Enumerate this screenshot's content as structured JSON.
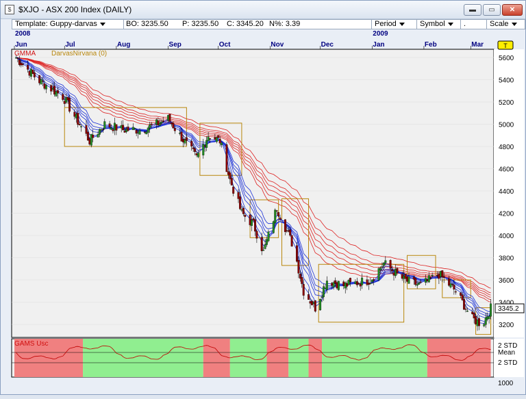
{
  "window": {
    "title": "$XJO - ASX 200 Index (DAILY)",
    "buttons": {
      "minimize": "▬",
      "maximize": "▭",
      "close": "✕"
    }
  },
  "toolbar": {
    "template_label": "Template: Guppy-darvas",
    "bo": "BO: 3235.50",
    "p": "P: 3235.50",
    "c": "C: 3345.20",
    "n": "N%: 3.39",
    "period_label": "Period",
    "symbol_label": "Symbol",
    "dot_label": ".",
    "scale_label": "Scale"
  },
  "chart": {
    "year_labels": [
      {
        "text": "2008",
        "date": "2008-06"
      },
      {
        "text": "2009",
        "date": "2009-01"
      }
    ],
    "month_labels": [
      "Jun",
      "Jul",
      "Aug",
      "Sep",
      "Oct",
      "Nov",
      "Dec",
      "Jan",
      "Feb",
      "Mar"
    ],
    "t_marker": "T",
    "indicator_gmma": "GMMA",
    "indicator_darvas": "DarvasNirvana (0)",
    "price_ticks": [
      "5600",
      "5400",
      "5200",
      "5000",
      "4800",
      "4600",
      "4400",
      "4200",
      "4000",
      "3800",
      "3600",
      "3400",
      "3200"
    ],
    "last_price_label": "3345.2",
    "osc_title": "GAMS Usc",
    "osc_labels": [
      "2 STD",
      "Mean",
      "2 STD"
    ],
    "osc_bottom_label": "1000",
    "colors": {
      "background": "#f0f0f0",
      "axis_text": "#000080",
      "long_mas": "#dd2222",
      "short_mas": "#1a2fd6",
      "darvas_box": "#b8860b",
      "osc_red": "#f08080",
      "osc_green": "#90ee90",
      "osc_line": "#c00000",
      "up_candle": "#228b22",
      "down_candle": "#8b0000"
    }
  },
  "chart_data": {
    "type": "candlestick-with-indicators",
    "symbol": "$XJO",
    "range": [
      "2008-06",
      "2009-03"
    ],
    "ylim": [
      3100,
      5650
    ],
    "y_ticks": [
      3200,
      3400,
      3600,
      3800,
      4000,
      4200,
      4400,
      4600,
      4800,
      5000,
      5200,
      5400,
      5600
    ],
    "last_close": 3345.2,
    "path": [
      [
        "2008-06-02",
        5600
      ],
      [
        "2008-06-15",
        5400
      ],
      [
        "2008-06-30",
        5250
      ],
      [
        "2008-07-10",
        5000
      ],
      [
        "2008-07-16",
        4850
      ],
      [
        "2008-07-25",
        5000
      ],
      [
        "2008-08-05",
        4950
      ],
      [
        "2008-08-15",
        4950
      ],
      [
        "2008-08-25",
        5000
      ],
      [
        "2008-09-01",
        5050
      ],
      [
        "2008-09-08",
        4900
      ],
      [
        "2008-09-18",
        4700
      ],
      [
        "2008-09-25",
        4900
      ],
      [
        "2008-10-02",
        4850
      ],
      [
        "2008-10-08",
        4500
      ],
      [
        "2008-10-15",
        4200
      ],
      [
        "2008-10-22",
        4100
      ],
      [
        "2008-10-28",
        3850
      ],
      [
        "2008-11-05",
        4250
      ],
      [
        "2008-11-15",
        3900
      ],
      [
        "2008-11-21",
        3500
      ],
      [
        "2008-11-28",
        3350
      ],
      [
        "2008-12-05",
        3600
      ],
      [
        "2008-12-15",
        3550
      ],
      [
        "2008-12-31",
        3600
      ],
      [
        "2009-01-08",
        3750
      ],
      [
        "2009-01-20",
        3600
      ],
      [
        "2009-01-30",
        3550
      ],
      [
        "2009-02-10",
        3650
      ],
      [
        "2009-02-20",
        3500
      ],
      [
        "2009-03-02",
        3250
      ],
      [
        "2009-03-08",
        3200
      ],
      [
        "2009-03-13",
        3345
      ]
    ],
    "darvas_boxes": [
      {
        "start": "2008-07-01",
        "end": "2008-09-12",
        "high": 5150,
        "low": 4800
      },
      {
        "start": "2008-09-20",
        "end": "2008-10-15",
        "high": 5010,
        "low": 4540
      },
      {
        "start": "2008-10-20",
        "end": "2008-11-06",
        "high": 4320,
        "low": 3980
      },
      {
        "start": "2008-11-08",
        "end": "2008-11-24",
        "high": 4330,
        "low": 3730
      },
      {
        "start": "2008-11-30",
        "end": "2009-01-20",
        "high": 3740,
        "low": 3220
      },
      {
        "start": "2009-01-22",
        "end": "2009-02-08",
        "high": 3820,
        "low": 3520
      },
      {
        "start": "2009-02-12",
        "end": "2009-03-01",
        "high": 3600,
        "low": 3440
      },
      {
        "start": "2009-03-04",
        "end": "2009-03-13",
        "high": 3350,
        "low": 3110
      }
    ],
    "oscillator_zones": [
      {
        "from": "2008-06-01",
        "to": "2008-07-12",
        "state": "bearish"
      },
      {
        "from": "2008-07-12",
        "to": "2008-09-22",
        "state": "bullish"
      },
      {
        "from": "2008-09-22",
        "to": "2008-10-08",
        "state": "bearish"
      },
      {
        "from": "2008-10-08",
        "to": "2008-10-30",
        "state": "bullish"
      },
      {
        "from": "2008-10-30",
        "to": "2008-11-12",
        "state": "bearish"
      },
      {
        "from": "2008-11-12",
        "to": "2008-11-24",
        "state": "bullish"
      },
      {
        "from": "2008-11-24",
        "to": "2008-12-02",
        "state": "bearish"
      },
      {
        "from": "2008-12-02",
        "to": "2009-02-03",
        "state": "bullish"
      },
      {
        "from": "2009-02-03",
        "to": "2009-03-13",
        "state": "bearish"
      }
    ]
  }
}
